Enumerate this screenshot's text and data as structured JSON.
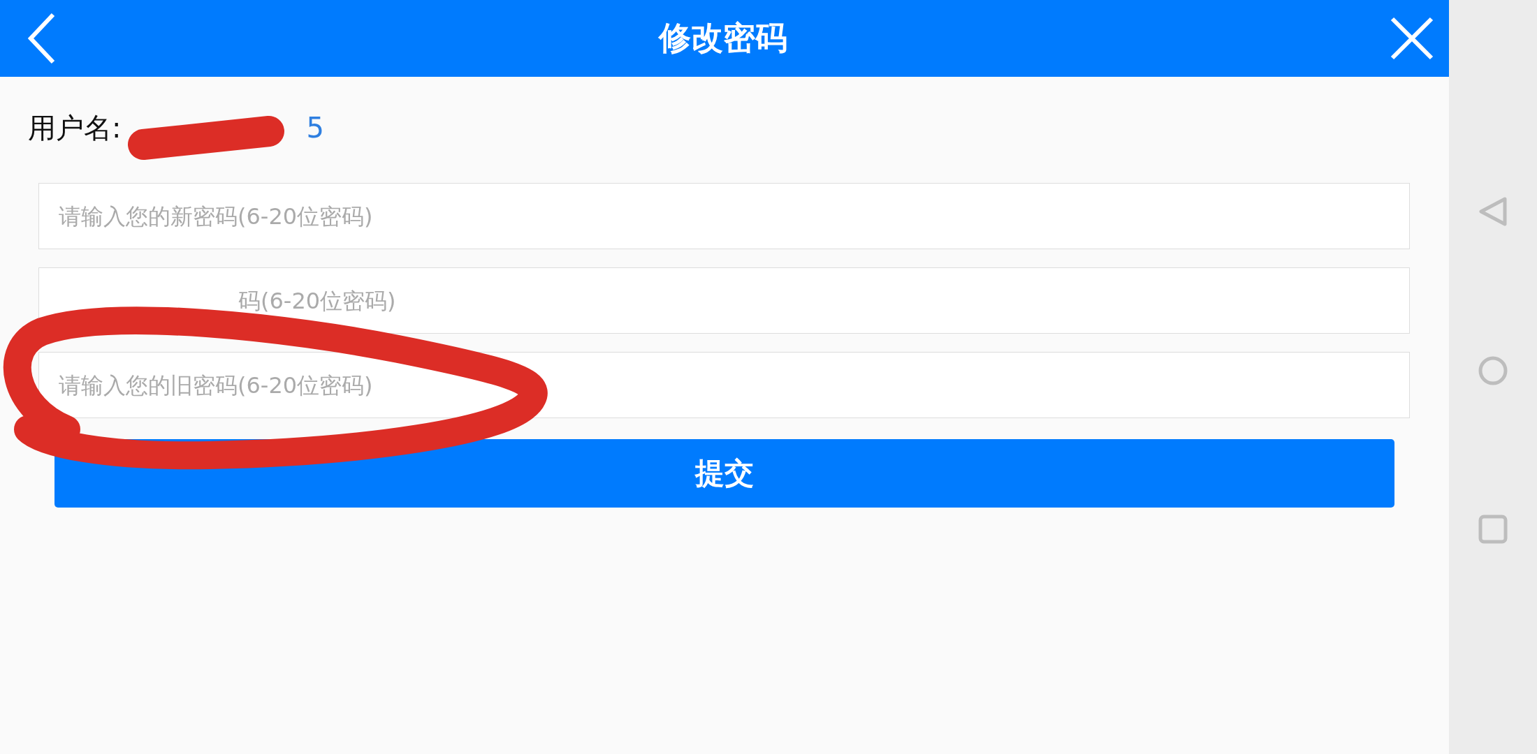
{
  "header": {
    "title": "修改密码"
  },
  "username": {
    "label": "用户名:",
    "value": "5"
  },
  "fields": [
    {
      "placeholder": "请输入您的新密码(6-20位密码)",
      "offset": false
    },
    {
      "placeholder": "码(6-20位密码)",
      "offset": true
    },
    {
      "placeholder": "请输入您的旧密码(6-20位密码)",
      "offset": false
    }
  ],
  "submit_button": "提交"
}
